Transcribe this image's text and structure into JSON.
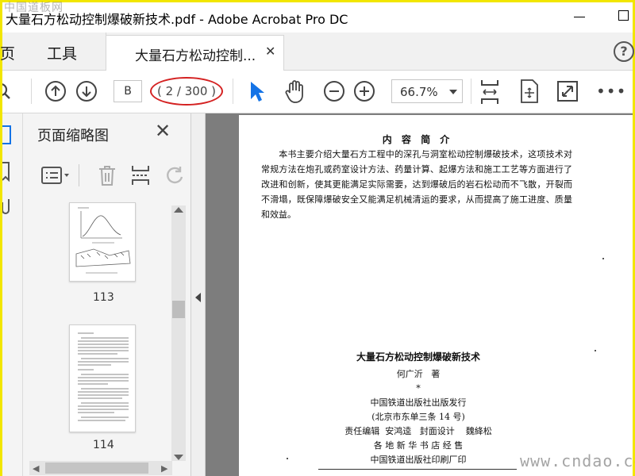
{
  "window": {
    "title": "大量石方松动控制爆破新技术.pdf - Adobe Acrobat Pro DC",
    "watermark_top": "中国道板网"
  },
  "menu": {
    "home": "主页",
    "tools": "工具",
    "document_tab": "大量石方松动控制...",
    "help": "?"
  },
  "toolbar": {
    "page_input": "B",
    "page_count": "( 2 / 300 )",
    "zoom": "66.7%",
    "more": "•••"
  },
  "thumbnails": {
    "title": "页面缩略图",
    "pages": [
      {
        "label": "113"
      },
      {
        "label": "114"
      }
    ]
  },
  "document": {
    "intro_heading": "内 容 简 介",
    "intro_text": "本书主要介绍大量石方工程中的深孔与洞室松动控制爆破技术，这项技术对常规方法在炮孔或药室设计方法、药量计算、起爆方法和施工工艺等方面进行了改进和创新，使其更能满足实际需要，达到爆破后的岩石松动而不飞散，开裂而不滑塌，既保障爆破安全又能满足机械清运的要求，从而提高了施工进度、质量和效益。",
    "book_title": "大量石方松动控制爆破新技术",
    "author": "何广沂   著",
    "asterisk": "*",
    "publisher": "中国铁道出版社出版发行",
    "address": "(北京市东单三条 14 号)",
    "editor": "责任编辑  安鸿逵   封面设计    魏絳松",
    "distributor": "各 地 新 华 书 店 经 售",
    "printer": "中国铁道出版社印刷厂印"
  },
  "watermark_bottom": "www.cndao.com",
  "colors": {
    "highlight_ring": "#d42121",
    "select_arrow": "#1473e6",
    "doc_background": "#7d7d7d"
  }
}
